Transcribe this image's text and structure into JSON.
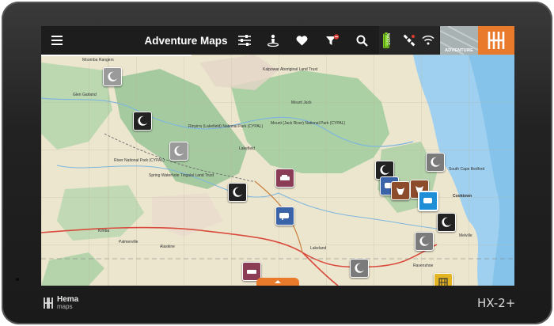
{
  "app": {
    "title": "Adventure Maps"
  },
  "toolbar": {
    "icons": [
      "menu-icon",
      "sliders-icon",
      "person-pin-icon",
      "heart-icon",
      "filter-icon",
      "search-icon"
    ]
  },
  "status": {
    "battery_percent": "100%"
  },
  "map_mode": {
    "label": "ADVENTURE"
  },
  "map_labels": [
    "Moomba Rangers",
    "Glen Garland",
    "Kalpowar Aboriginal Land Trust",
    "Mount Jack",
    "Mount (Jack River) National Park (CYPAL)",
    "Rinyirru (Lakefield) National Park (CYPAL)",
    "Lakefield",
    "River National Park (CYPAL)",
    "Spring Waterhole Tingalai Land Trust",
    "Kimba",
    "Palmerville",
    "Alaskine",
    "Lakeland",
    "Cooktown",
    "South Cape Bedford",
    "Melville",
    "Ravenshoe"
  ],
  "device": {
    "brand": "Hema",
    "brand_sub": "maps",
    "model": "HX-2+"
  },
  "colors": {
    "accent": "#e97a2c",
    "topbar": "#1d1d1d",
    "bezel": "#222222"
  }
}
